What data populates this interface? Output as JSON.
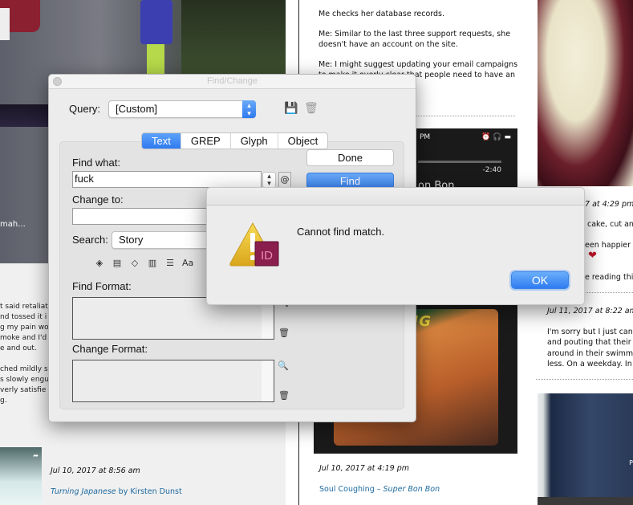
{
  "background": {
    "left_column": {
      "photo_caption": "mah...",
      "excerpt_lines": [
        "t said retaliat",
        "nd tossed it i",
        "g my pain wo",
        "moke and I'd I",
        "e and out.",
        "",
        "ched mildly sa",
        "s slowly engu",
        "verly satisfie",
        "g."
      ],
      "post": {
        "date": "Jul 10, 2017 at 8:56 am",
        "link_title": "Turning Japanese",
        "link_rest": " by Kirsten Dunst"
      }
    },
    "middle_column": {
      "paragraphs": [
        "Me checks her database records.",
        "Me: Similar to the last three support requests, she doesn't have an account on the site.",
        "Me: I might suggest updating your email campaigns to make it overly clear that people need to have an account before they"
      ],
      "phone_screenshot": {
        "status_time": "PM",
        "remaining": "-2:40",
        "song_partial": "on Bon",
        "cover_title": "UGHING"
      },
      "post": {
        "date": "Jul 10, 2017 at 4:19 pm",
        "link_artist": "Soul Coughing",
        "link_sep": " – ",
        "link_title": "Super Bon Bon"
      }
    },
    "right_column": {
      "comment1_date": "7 at 4:29 pm",
      "comment1_lines": [
        "cake, cut and",
        "een happier",
        "e reading thi"
      ],
      "comment2_date": "Jul 11, 2017 at 8:22 am",
      "comment2_lines": [
        "I'm sorry but I just can't",
        "and pouting that their l",
        "around in their swimmi",
        "less. On a weekday. In th"
      ],
      "thumb_text": "P"
    }
  },
  "find_change": {
    "title": "Find/Change",
    "query_label": "Query:",
    "query_value": "[Custom]",
    "tabs": [
      {
        "label": "Text",
        "active": true
      },
      {
        "label": "GREP",
        "active": false
      },
      {
        "label": "Glyph",
        "active": false
      },
      {
        "label": "Object",
        "active": false
      }
    ],
    "find_what_label": "Find what:",
    "find_what_value": "fuck",
    "change_to_label": "Change to:",
    "change_to_value": "",
    "search_label": "Search:",
    "search_value": "Story",
    "buttons": {
      "done": "Done",
      "find": "Find"
    },
    "find_format_label": "Find Format:",
    "change_format_label": "Change Format:",
    "case_icon_text": "Aa",
    "special_char_icon": "@"
  },
  "alert": {
    "message": "Cannot find match.",
    "ok_label": "OK",
    "app_badge": "ID"
  }
}
